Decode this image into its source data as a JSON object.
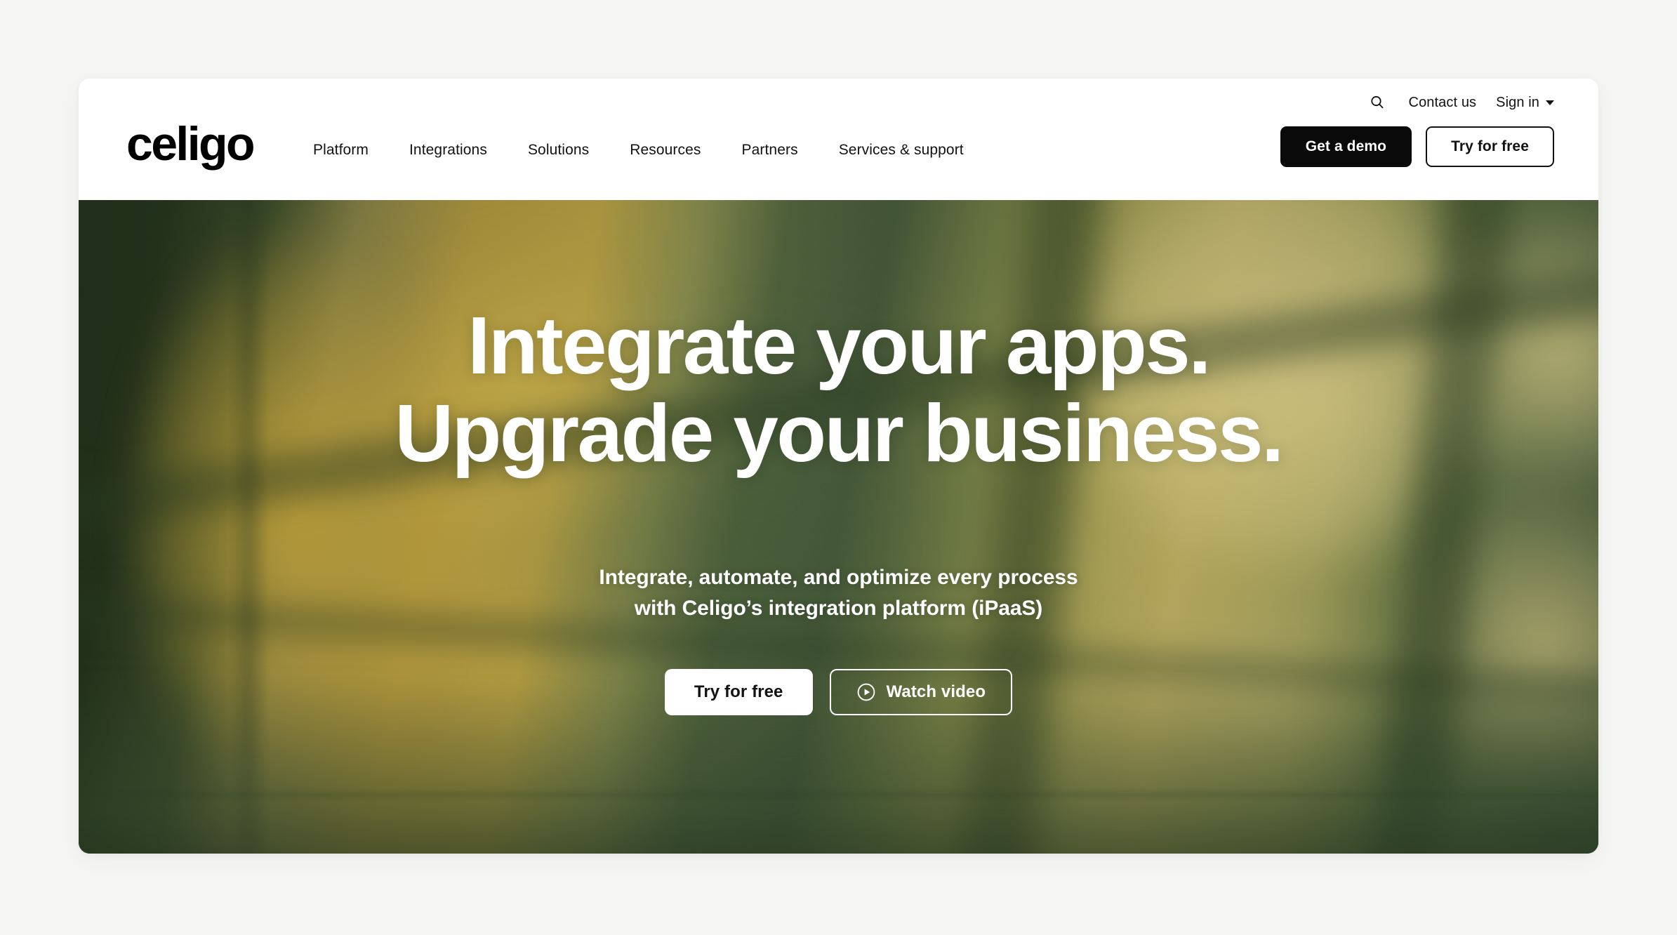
{
  "header": {
    "logo": "celigo",
    "utility": {
      "search_icon": "search-icon",
      "contact_label": "Contact us",
      "signin_label": "Sign in",
      "signin_caret_icon": "chevron-down-icon"
    },
    "nav_items": [
      {
        "label": "Platform"
      },
      {
        "label": "Integrations"
      },
      {
        "label": "Solutions"
      },
      {
        "label": "Resources"
      },
      {
        "label": "Partners"
      },
      {
        "label": "Services & support"
      }
    ],
    "ctas": {
      "demo_label": "Get a demo",
      "trial_label": "Try for free"
    }
  },
  "hero": {
    "headline_line1": "Integrate your apps.",
    "headline_line2": "Upgrade your business.",
    "sub_line1": "Integrate, automate, and optimize every process",
    "sub_line2": "with Celigo’s integration platform (iPaaS)",
    "cta_primary": "Try for free",
    "cta_secondary": "Watch video",
    "play_icon": "play-circle-icon"
  },
  "colors": {
    "page_backdrop": "#f5f5f4",
    "card_background": "#ffffff",
    "text_primary": "#121212",
    "button_dark": "#0a0a0a",
    "hero_green_dark": "#22301a",
    "hero_green_mid": "#4d5c3c",
    "hero_gold": "#c2a645",
    "hero_pane_light": "#d6c885",
    "hero_text": "#ffffff"
  }
}
